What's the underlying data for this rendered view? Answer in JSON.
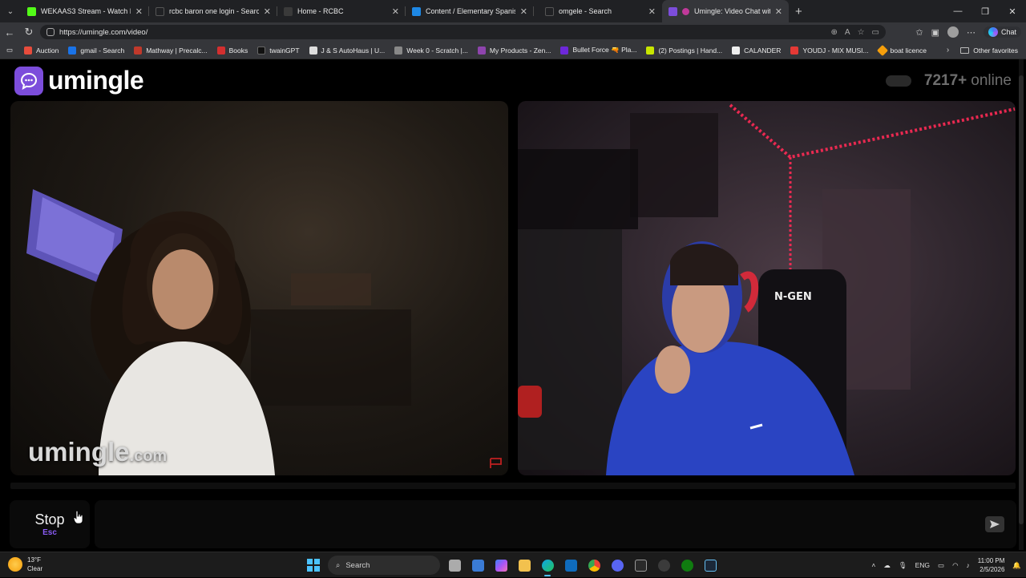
{
  "browser": {
    "tabs": [
      {
        "title": "WEKAAS3 Stream - Watch Live on",
        "color": "#53fc18"
      },
      {
        "title": "rcbc baron one login - Search",
        "color": "#202124"
      },
      {
        "title": "Home - RCBC",
        "color": "#3a3a3a"
      },
      {
        "title": "Content / Elementary Spanish I (S",
        "color": "#1e88e5"
      },
      {
        "title": "omgele - Search",
        "color": "#202124"
      },
      {
        "title": "Umingle: Video Chat with Stra",
        "color": "#7c4ddb"
      }
    ],
    "url": "https://umingle.com/video/",
    "copilot_label": "Chat",
    "bookmarks": [
      {
        "label": "Auction",
        "color": "#e74c3c"
      },
      {
        "label": "gmail - Search",
        "color": "#1a73e8"
      },
      {
        "label": "Mathway | Precalc...",
        "color": "#c0392b"
      },
      {
        "label": "Books",
        "color": "#d32f2f"
      },
      {
        "label": "twainGPT",
        "color": "#111111"
      },
      {
        "label": "J & S AutoHaus | U...",
        "color": "#dddddd"
      },
      {
        "label": "Week 0 - Scratch |...",
        "color": "#888888"
      },
      {
        "label": "My Products - Zen...",
        "color": "#8e44ad"
      },
      {
        "label": "Bullet Force 🔫 Pla...",
        "color": "#6d28d9"
      },
      {
        "label": "(2) Postings | Hand...",
        "color": "#c8e600"
      },
      {
        "label": "CALANDER",
        "color": "#eeeeee"
      },
      {
        "label": "YOUDJ - MIX MUSI...",
        "color": "#e53935"
      },
      {
        "label": "boat licence",
        "color": "#f59e0b"
      }
    ],
    "other_favorites": "Other favorites"
  },
  "site": {
    "brand": "umingle",
    "online_count": "7217+",
    "online_label": "online",
    "watermark_main": "umingle",
    "watermark_suffix": ".com",
    "stop_label": "Stop",
    "stop_key": "Esc",
    "accent": "#7c4ddb"
  },
  "taskbar": {
    "temp": "13°F",
    "condition": "Clear",
    "search_label": "Search",
    "lang": "ENG",
    "time": "11:00 PM",
    "date": "2/5/2026"
  }
}
